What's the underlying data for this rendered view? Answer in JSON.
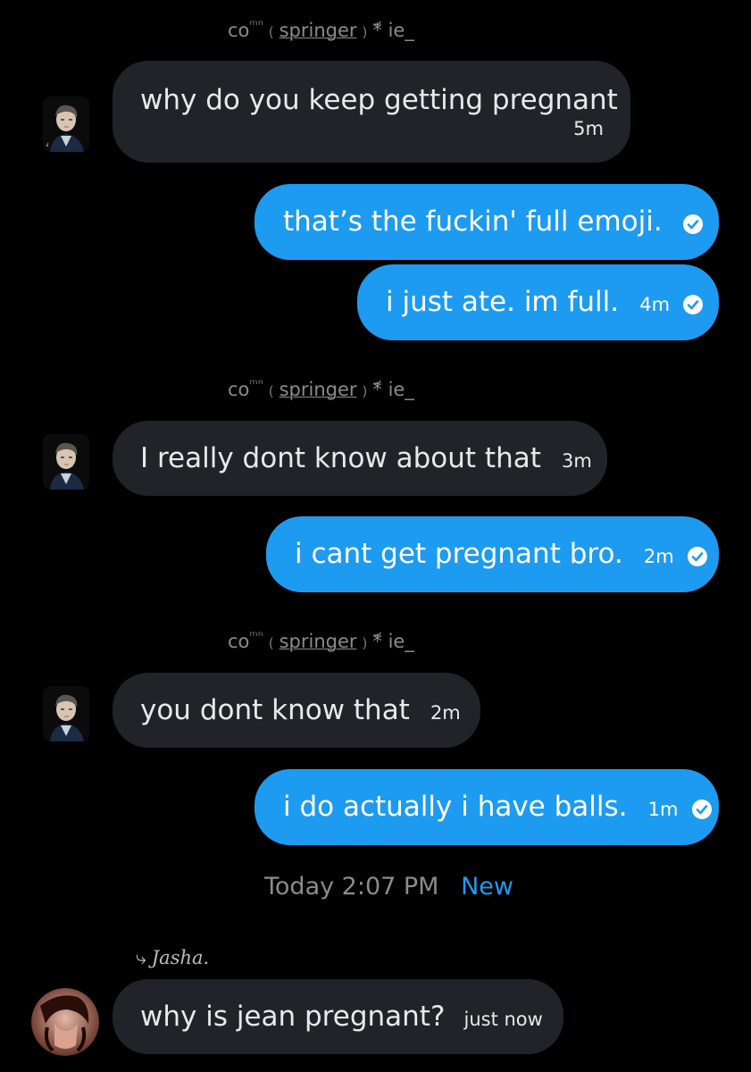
{
  "threads": [
    {
      "sender_label": {
        "prefix": "co",
        "sup": "ᵐⁿ",
        "open": "(",
        "name": "springer",
        "close": ")",
        "suffix": "*͘ ie_"
      },
      "messages": [
        {
          "text": "why do you keep getting pregnant",
          "time": "5m"
        }
      ]
    }
  ],
  "msg1": {
    "text": "why do you keep getting pregnant",
    "time": "5m"
  },
  "out1": {
    "text": "that’s the fuckin' full emoji."
  },
  "out2": {
    "text": "i just ate. im full.",
    "time": "4m"
  },
  "sender": {
    "prefix": "co",
    "sup": "ᵐⁿ",
    "open": "(",
    "name": "springer",
    "close": ")",
    "suffix": "*᷄ ie_"
  },
  "msg2": {
    "text": "I really dont know about that",
    "time": "3m"
  },
  "out3": {
    "text": "i cant get pregnant bro.",
    "time": "2m"
  },
  "msg3": {
    "text": "you dont know that",
    "time": "2m"
  },
  "out4": {
    "text": "i do actually i have balls.",
    "time": "1m"
  },
  "divider": {
    "time": "Today 2:07 PM",
    "new_label": "New"
  },
  "sender2": {
    "arrow": "⤷",
    "name": "Jasha."
  },
  "msg4": {
    "text": "why is jean pregnant?",
    "time": "just now"
  },
  "colors": {
    "incoming": "#202327",
    "outgoing": "#1d9bf0",
    "new": "#1d9bf0",
    "muted": "#8b8b8b"
  }
}
